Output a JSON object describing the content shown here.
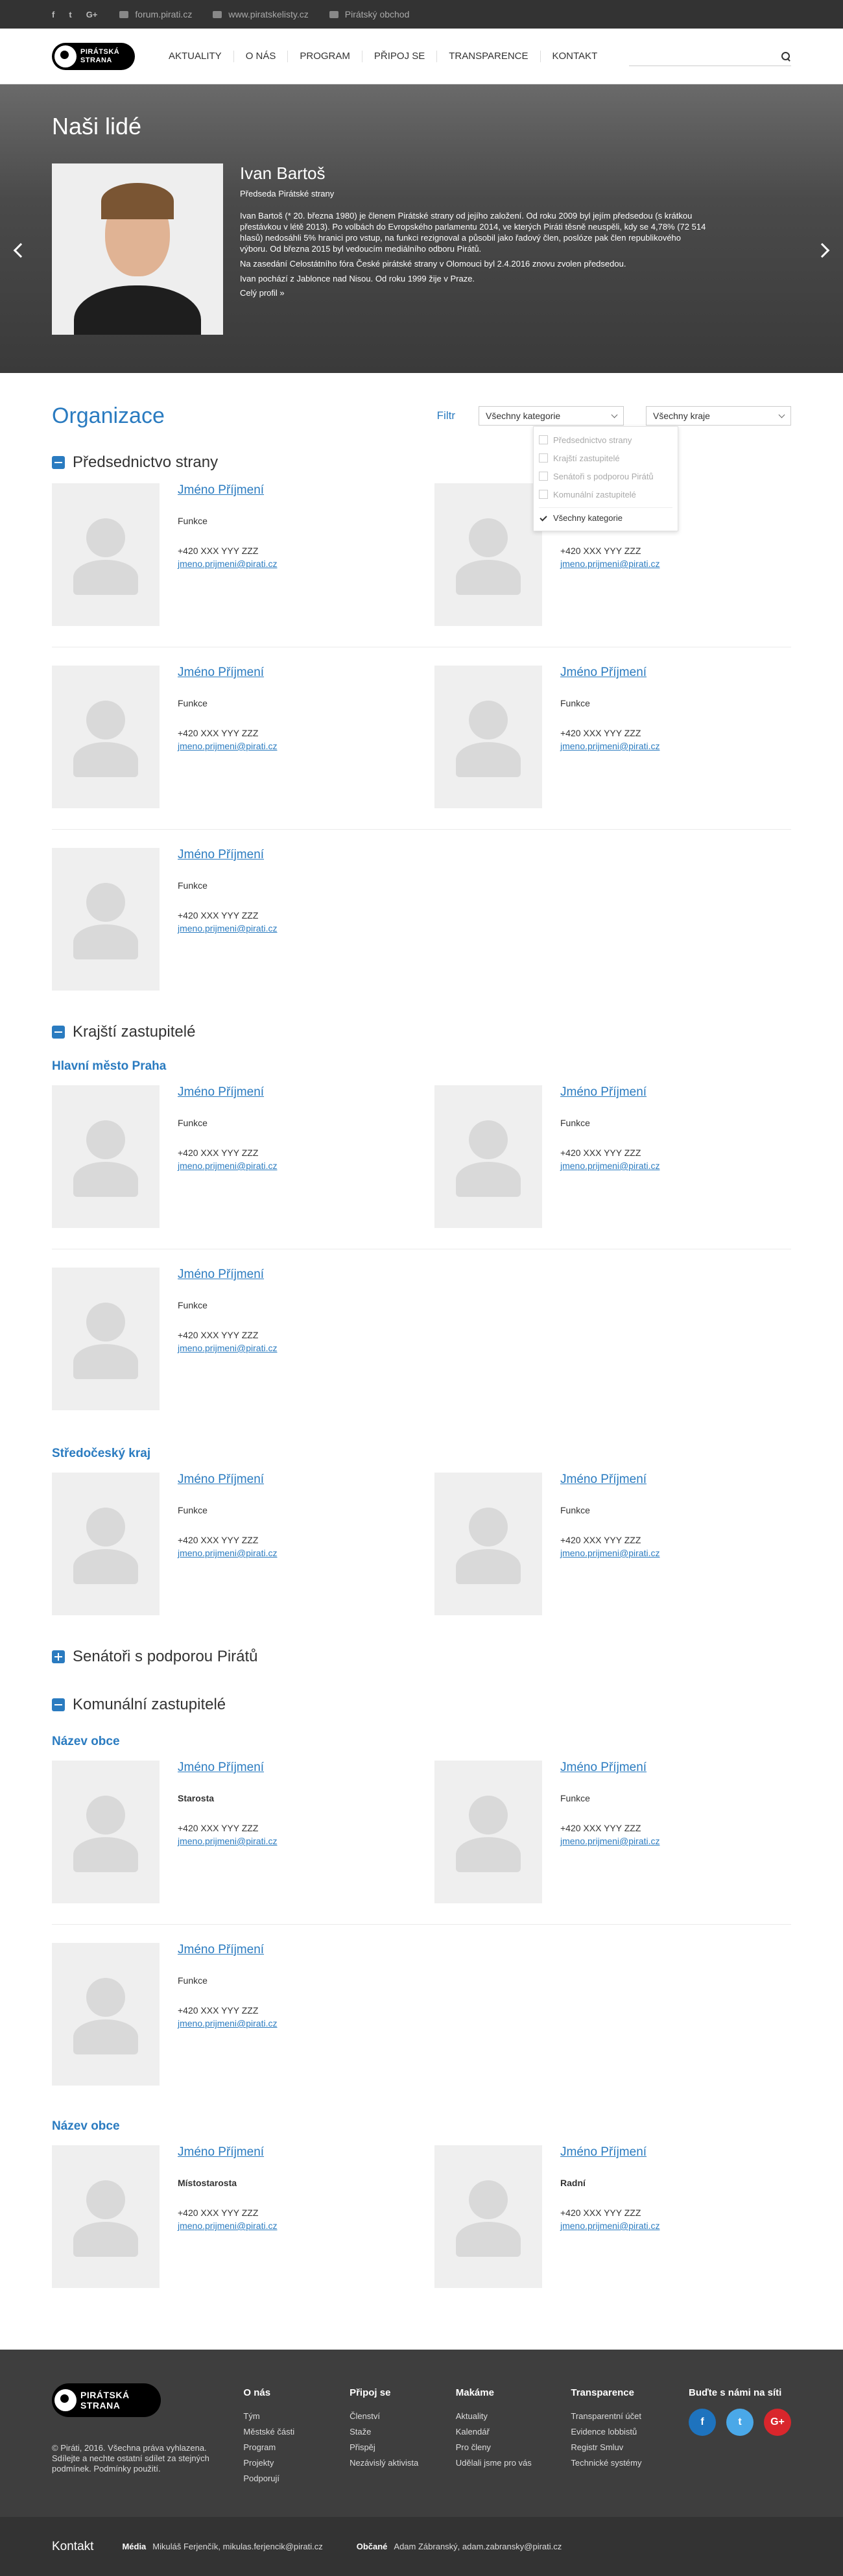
{
  "topbar": {
    "social": [
      "f",
      "t",
      "G+"
    ],
    "links": [
      "forum.pirati.cz",
      "www.piratskelisty.cz",
      "Pirátský obchod"
    ]
  },
  "logo": {
    "line1": "PIRÁTSKÁ",
    "line2": "STRANA"
  },
  "nav": [
    "AKTUALITY",
    "O NÁS",
    "PROGRAM",
    "PŘIPOJ SE",
    "TRANSPARENCE",
    "KONTAKT"
  ],
  "hero": {
    "title": "Naši lidé",
    "name": "Ivan Bartoš",
    "role": "Předseda Pirátské strany",
    "p1": "Ivan Bartoš (* 20. března 1980) je členem Pirátské strany od jejího založení. Od roku 2009 byl jejím předsedou (s krátkou přestávkou v létě 2013). Po volbách do Evropského parlamentu 2014, ve kterých Piráti těsně neuspěli, kdy se 4,78% (72 514 hlasů) nedosáhli 5% hranici pro vstup, na funkci rezignoval a působil jako řadový člen, poslóze pak člen republikového výboru. Od března 2015 byl vedoucím mediálního odboru Pirátů.",
    "p2": "Na zasedání Celostátního fóra České pirátské strany v Olomouci byl 2.4.2016 znovu zvolen předsedou.",
    "p3": "Ivan pochází z Jablonce nad Nisou. Od roku 1999 žije v Praze.",
    "more": "Celý profil »"
  },
  "org": {
    "title": "Organizace",
    "filter_label": "Filtr",
    "category_select": "Všechny kategorie",
    "region_select": "Všechny kraje",
    "dropdown": [
      "Předsednictvo strany",
      "Krajští zastupitelé",
      "Senátoři s podporou Pirátů",
      "Komunální zastupitelé"
    ],
    "dropdown_active": "Všechny kategorie"
  },
  "person": {
    "name": "Jméno Příjmení",
    "phone": "+420 XXX YYY ZZZ",
    "email": "jmeno.prijmeni@pirati.cz"
  },
  "sections": {
    "s1": "Předsednictvo strany",
    "s2": "Krajští zastupitelé",
    "s2_r1": "Hlavní město Praha",
    "s2_r2": "Středočeský kraj",
    "s3": "Senátoři s podporou Pirátů",
    "s4": "Komunální zastupitelé",
    "s4_r1": "Název obce",
    "s4_r2": "Název obce"
  },
  "functions": {
    "generic": "Funkce",
    "starosta": "Starosta",
    "mistostarosta": "Místostarosta",
    "radni": "Radní"
  },
  "footer": {
    "copy_line1": "© Piráti, 2016. Všechna práva vyhlazena.",
    "copy_line2": "Sdílejte a nechte ostatní sdílet za stejných podmínek.",
    "terms": "Podmínky použití.",
    "columns": [
      {
        "title": "O nás",
        "items": [
          "Tým",
          "Městské části",
          "Program",
          "Projekty",
          "Podporují"
        ]
      },
      {
        "title": "Připoj se",
        "items": [
          "Členství",
          "Staže",
          "Přispěj",
          "Nezávislý aktivista"
        ]
      },
      {
        "title": "Makáme",
        "items": [
          "Aktuality",
          "Kalendář",
          "Pro členy",
          "Udělali jsme pro vás"
        ]
      },
      {
        "title": "Transparence",
        "items": [
          "Transparentní účet",
          "Evidence lobbistů",
          "Registr Smluv",
          "Technické systémy"
        ]
      }
    ],
    "social_title": "Buďte s námi na síti",
    "social_icons": [
      "f",
      "t",
      "G+"
    ],
    "social_colors": [
      "#1e73be",
      "#4aa8e8",
      "#d9262c"
    ]
  },
  "bottom": {
    "title": "Kontakt",
    "media_label": "Média",
    "media_value": "Mikuláš Ferjenčík, mikulas.ferjencik@pirati.cz",
    "obcane_label": "Občané",
    "obcane_value": "Adam Zábranský, adam.zabransky@pirati.cz"
  }
}
